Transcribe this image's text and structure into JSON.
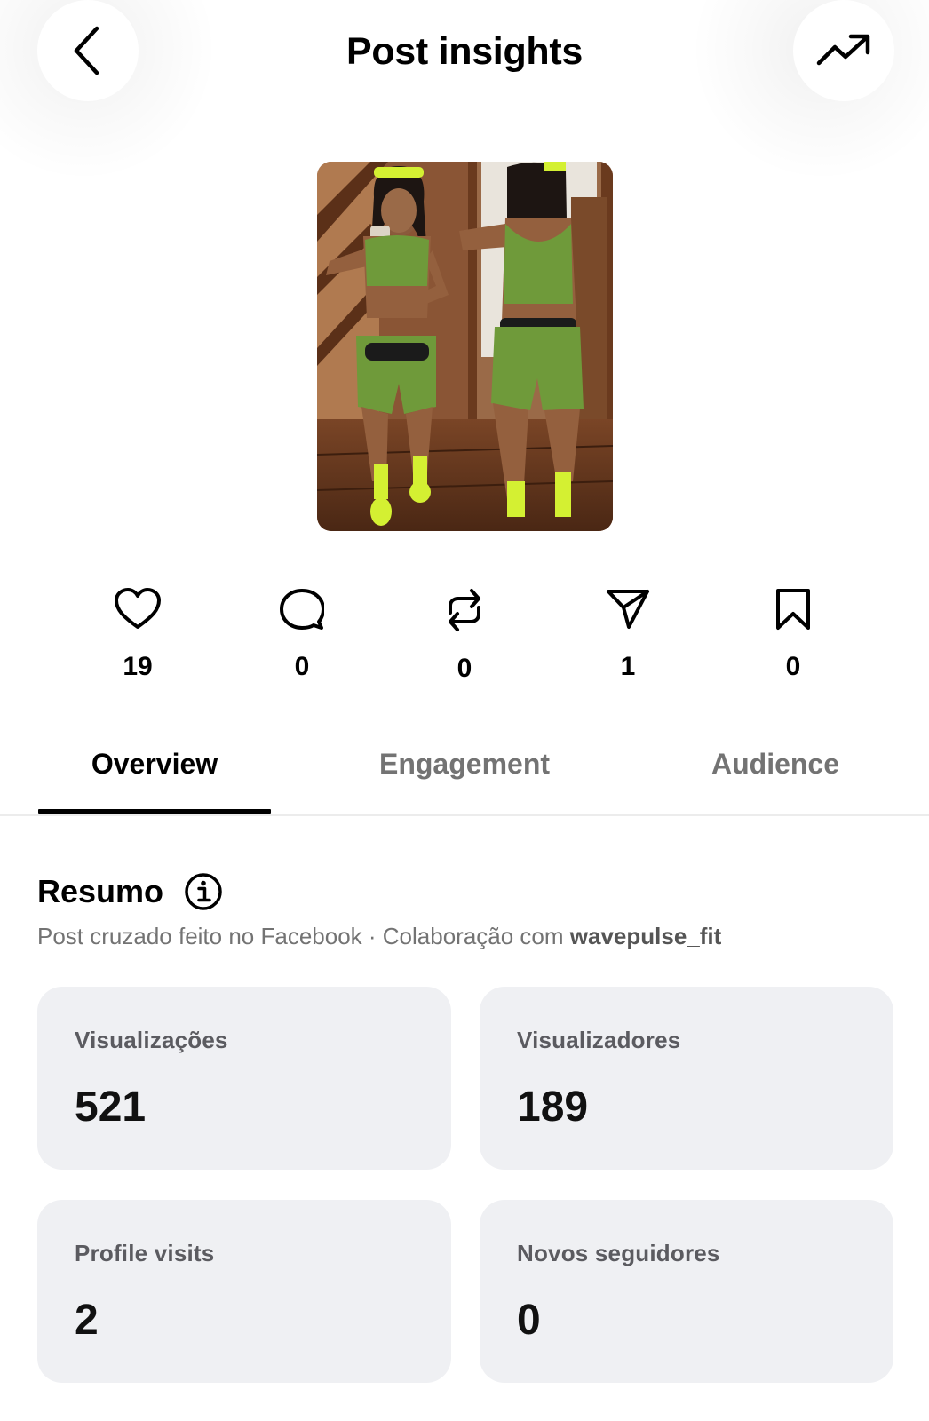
{
  "header": {
    "title": "Post insights",
    "back_icon": "chevron-left-icon",
    "trend_icon": "trending-up-icon"
  },
  "post": {
    "thumbnail_description": "photo of woman in green workout outfit taking mirror selfie"
  },
  "interactions": [
    {
      "icon": "heart-icon",
      "value": "19"
    },
    {
      "icon": "comment-icon",
      "value": "0"
    },
    {
      "icon": "repost-icon",
      "value": "0"
    },
    {
      "icon": "share-icon",
      "value": "1"
    },
    {
      "icon": "bookmark-icon",
      "value": "0"
    }
  ],
  "tabs": [
    {
      "label": "Overview",
      "active": true
    },
    {
      "label": "Engagement",
      "active": false
    },
    {
      "label": "Audience",
      "active": false
    }
  ],
  "summary": {
    "title": "Resumo",
    "subtitle_prefix": "Post cruzado feito no Facebook · Colaboração com ",
    "collab_handle": "wavepulse_fit"
  },
  "metrics": [
    {
      "label": "Visualizações",
      "value": "521"
    },
    {
      "label": "Visualizadores",
      "value": "189"
    },
    {
      "label": "Profile visits",
      "value": "2"
    },
    {
      "label": "Novos seguidores",
      "value": "0"
    }
  ],
  "colors": {
    "card_background": "#eff0f3",
    "muted_text": "#737373",
    "outfit_green": "#6f9a3a",
    "neon_accent": "#d4f032"
  }
}
